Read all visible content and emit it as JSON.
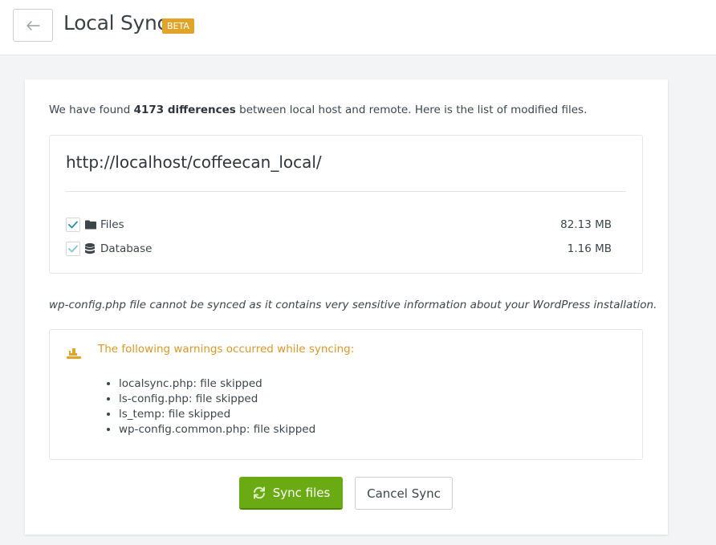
{
  "header": {
    "title": "Local Sync",
    "badge": "BETA",
    "back_icon": "arrow-left-icon"
  },
  "summary": {
    "prefix": "We have found ",
    "count_text": "4173 differences",
    "suffix": " between local host and remote. Here is the list of modified files."
  },
  "site": {
    "url": "http://localhost/coffeecan_local/",
    "rows": [
      {
        "label": "Files",
        "size": "82.13 MB",
        "icon": "folder-icon",
        "checked": true
      },
      {
        "label": "Database",
        "size": "1.16 MB",
        "icon": "database-icon",
        "checked": true
      }
    ]
  },
  "note": "wp-config.php file cannot be synced as it contains very sensitive information about your WordPress installation.",
  "warnings": {
    "title": "The following warnings occurred while syncing:",
    "icon": "warning-icon",
    "items": [
      "localsync.php: file skipped",
      "ls-config.php: file skipped",
      "ls_temp: file skipped",
      "wp-config.common.php: file skipped"
    ]
  },
  "actions": {
    "sync_label": "Sync files",
    "cancel_label": "Cancel Sync"
  },
  "colors": {
    "accent_green": "#6aab14",
    "badge_orange": "#e0a429",
    "warning_text": "#d9982a",
    "check_teal": "#2b8fa3"
  }
}
